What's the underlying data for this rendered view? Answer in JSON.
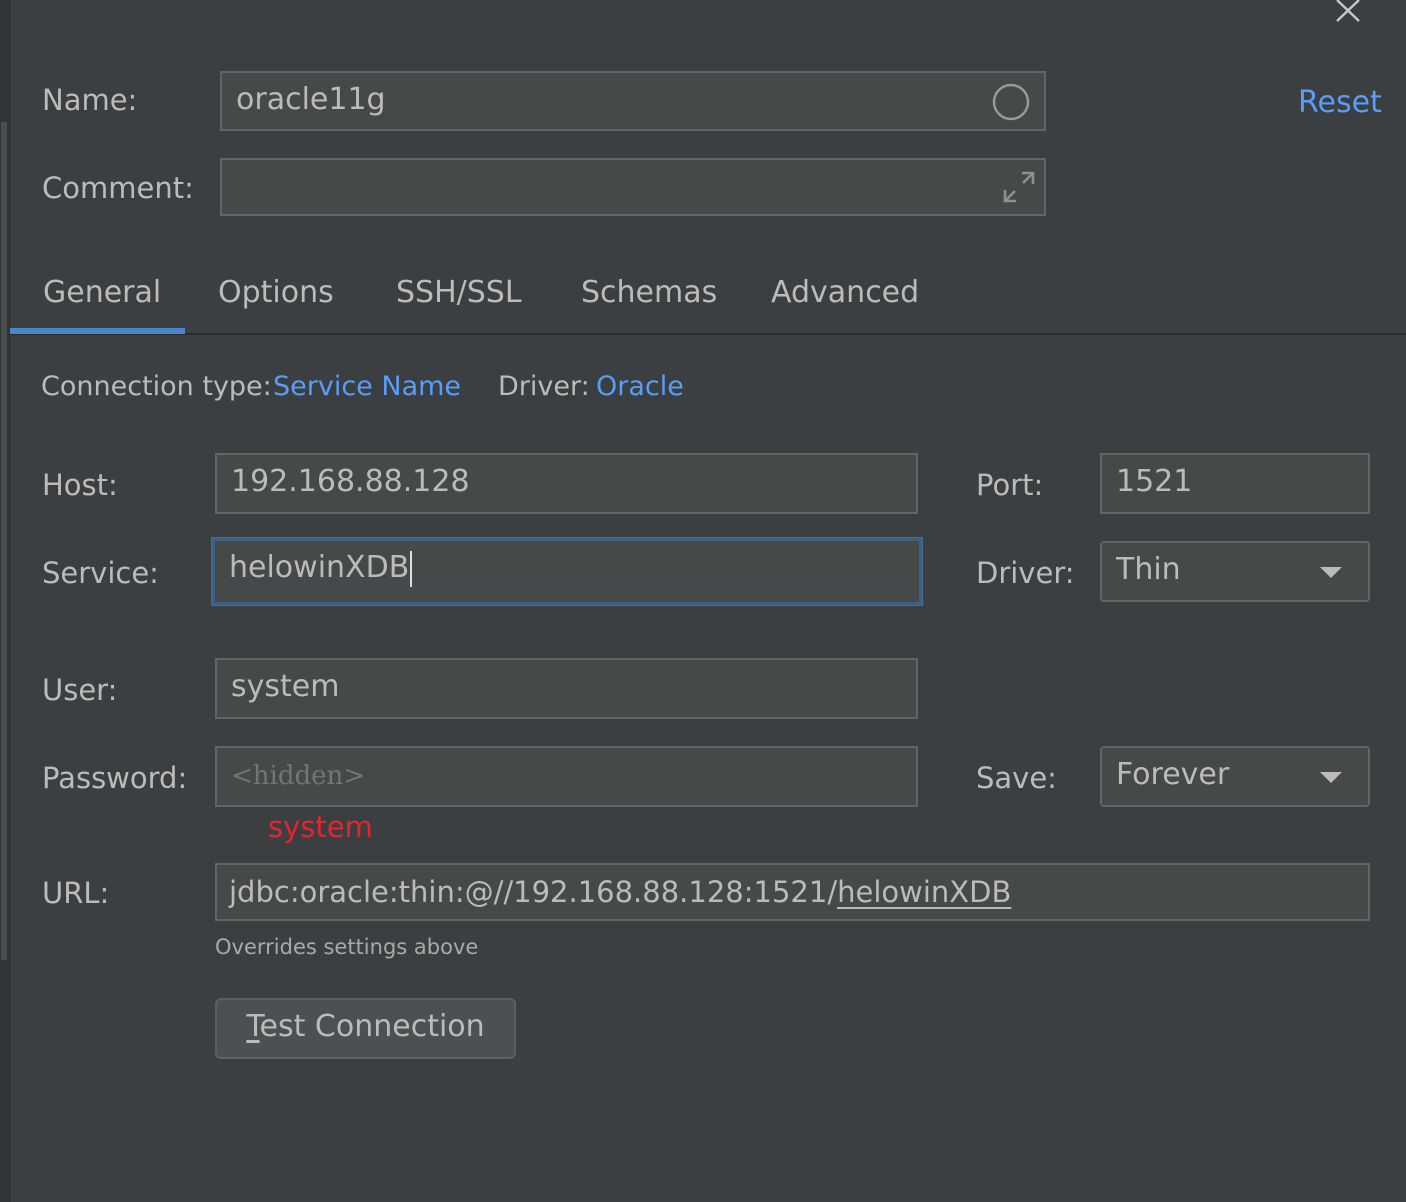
{
  "header": {
    "name_label": "Name:",
    "name_value": "oracle11g",
    "comment_label": "Comment:",
    "comment_value": "",
    "reset_label": "Reset"
  },
  "tabs": [
    {
      "label": "General",
      "selected": true
    },
    {
      "label": "Options",
      "selected": false
    },
    {
      "label": "SSH/SSL",
      "selected": false
    },
    {
      "label": "Schemas",
      "selected": false
    },
    {
      "label": "Advanced",
      "selected": false
    }
  ],
  "connection": {
    "type_label": "Connection type:",
    "type_value": "Service Name",
    "driver_label": "Driver:",
    "driver_value": "Oracle"
  },
  "form": {
    "host_label": "Host:",
    "host_value": "192.168.88.128",
    "port_label": "Port:",
    "port_value": "1521",
    "service_label": "Service:",
    "service_value": "helowinXDB",
    "driver_label": "Driver:",
    "driver_select": "Thin",
    "user_label": "User:",
    "user_value": "system",
    "password_label": "Password:",
    "password_placeholder": "<hidden>",
    "password_annotation": "system",
    "save_label": "Save:",
    "save_select": "Forever",
    "url_label": "URL:",
    "url_prefix": "jdbc:oracle:thin:@//192.168.88.128:1521/",
    "url_link": "helowinXDB",
    "url_hint": "Overrides settings above"
  },
  "test_button": {
    "mnemonic": "T",
    "rest": "est Connection"
  },
  "colors": {
    "background": "#3c3f41",
    "field_bg": "#45494a",
    "link": "#589df6",
    "tab_underline": "#4a88c7",
    "annotation": "#e0262e"
  },
  "icons": [
    "close-icon",
    "loading-circle-icon",
    "expand-icon",
    "chevron-down-icon"
  ]
}
